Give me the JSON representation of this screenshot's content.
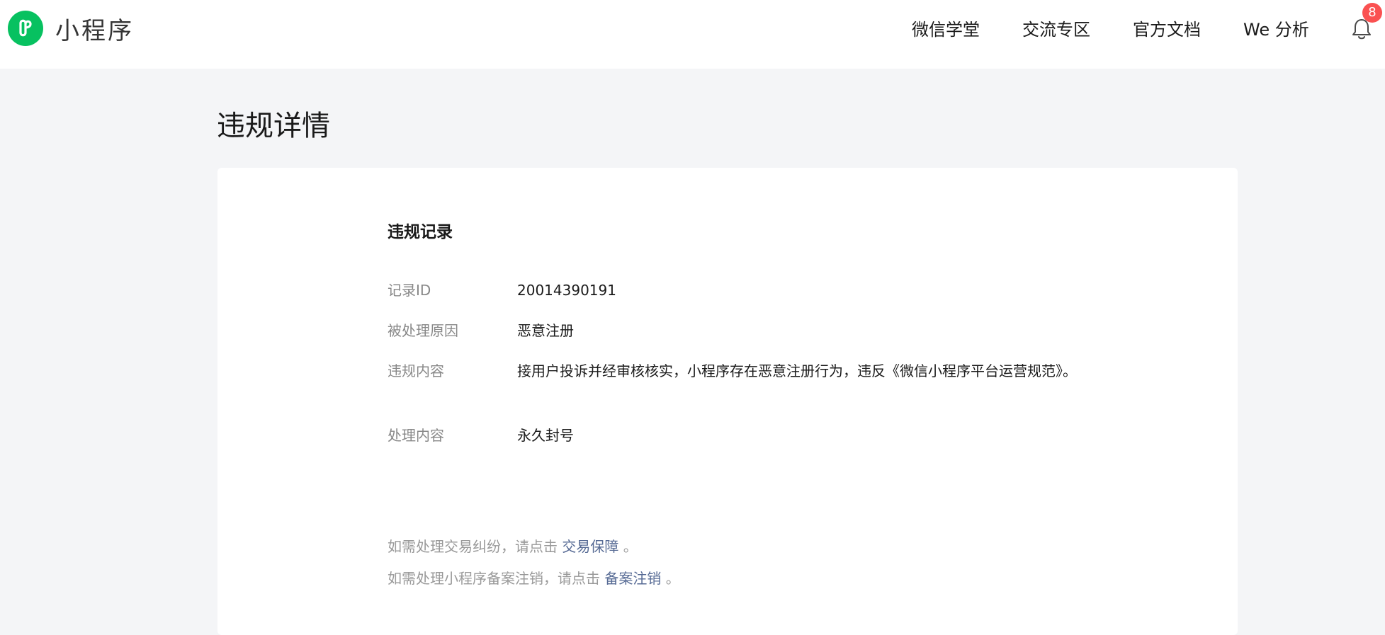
{
  "header": {
    "logo_text": "小程序",
    "logo_icon": "miniprogram-logo-icon",
    "brand_color": "#07c160",
    "nav": [
      {
        "label": "微信学堂"
      },
      {
        "label": "交流专区"
      },
      {
        "label": "官方文档"
      },
      {
        "label": "We 分析"
      }
    ],
    "notification_icon": "bell-icon",
    "notification_count": "8",
    "badge_color": "#fa5151"
  },
  "page": {
    "title": "违规详情"
  },
  "record": {
    "section_title": "违规记录",
    "rows": [
      {
        "label": "记录ID",
        "value": "20014390191"
      },
      {
        "label": "被处理原因",
        "value": "恶意注册"
      },
      {
        "label": "违规内容",
        "value": "接用户投诉并经审核核实，小程序存在恶意注册行为，违反《微信小程序平台运营规范》。"
      },
      {
        "label": "处理内容",
        "value": "永久封号"
      }
    ]
  },
  "notes": [
    {
      "prefix": "如需处理交易纠纷，请点击 ",
      "link": "交易保障",
      "suffix": " 。"
    },
    {
      "prefix": "如需处理小程序备案注销，请点击 ",
      "link": "备案注销",
      "suffix": " 。"
    }
  ],
  "link_color": "#576b95"
}
